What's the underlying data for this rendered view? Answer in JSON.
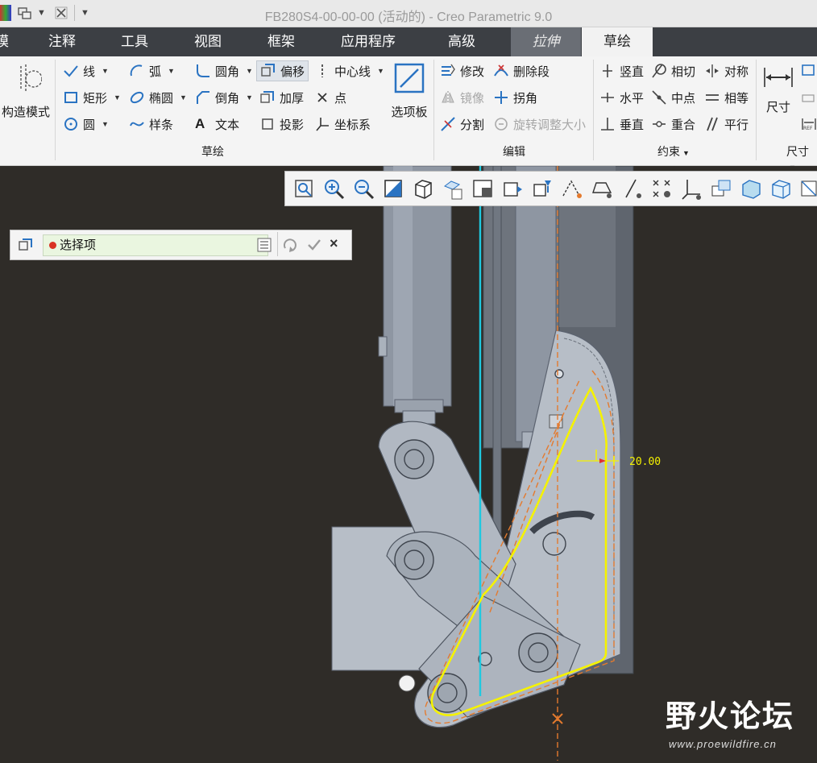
{
  "window": {
    "title": "FB280S4-00-00-00 (活动的) - Creo Parametric 9.0"
  },
  "tabs": [
    {
      "label": "模"
    },
    {
      "label": "注释"
    },
    {
      "label": "工具"
    },
    {
      "label": "视图"
    },
    {
      "label": "框架"
    },
    {
      "label": "应用程序"
    },
    {
      "label": "高级"
    },
    {
      "label": "拉伸"
    },
    {
      "label": "草绘"
    }
  ],
  "ribbon": {
    "construction_mode": "构造模式",
    "sketch": {
      "line": "线",
      "arc": "弧",
      "fillet": "圆角",
      "offset": "偏移",
      "centerline": "中心线",
      "rectangle": "矩形",
      "ellipse": "椭圆",
      "chamfer": "倒角",
      "thicken": "加厚",
      "point": "点",
      "circle": "圆",
      "spline": "样条",
      "text": "文本",
      "project": "投影",
      "coord_sys": "坐标系",
      "palette": "选项板",
      "group": "草绘"
    },
    "edit": {
      "modify": "修改",
      "delete_segment": "删除段",
      "mirror": "镜像",
      "corner": "拐角",
      "divide": "分割",
      "rotate_resize": "旋转调整大小",
      "group": "编辑"
    },
    "constrain": {
      "vertical": "竖直",
      "tangent": "相切",
      "symmetric": "对称",
      "horizontal": "水平",
      "midpoint": "中点",
      "equal": "相等",
      "perpendicular": "垂直",
      "coincident": "重合",
      "parallel": "平行",
      "group": "约束"
    },
    "dimension": {
      "label": "尺寸",
      "group": "尺寸"
    }
  },
  "selection": {
    "label": "选择项"
  },
  "dimension_value": "20.00",
  "watermark": {
    "text": "野火论坛",
    "url": "www.proewildfire.cn"
  },
  "colors": {
    "sketch": "#f5f200",
    "centerline": "#1ec9e0",
    "dim": "#f5f200",
    "part": "#b9c0c9",
    "dark": "#2f2c28",
    "tab_bar": "#3c3f44"
  }
}
